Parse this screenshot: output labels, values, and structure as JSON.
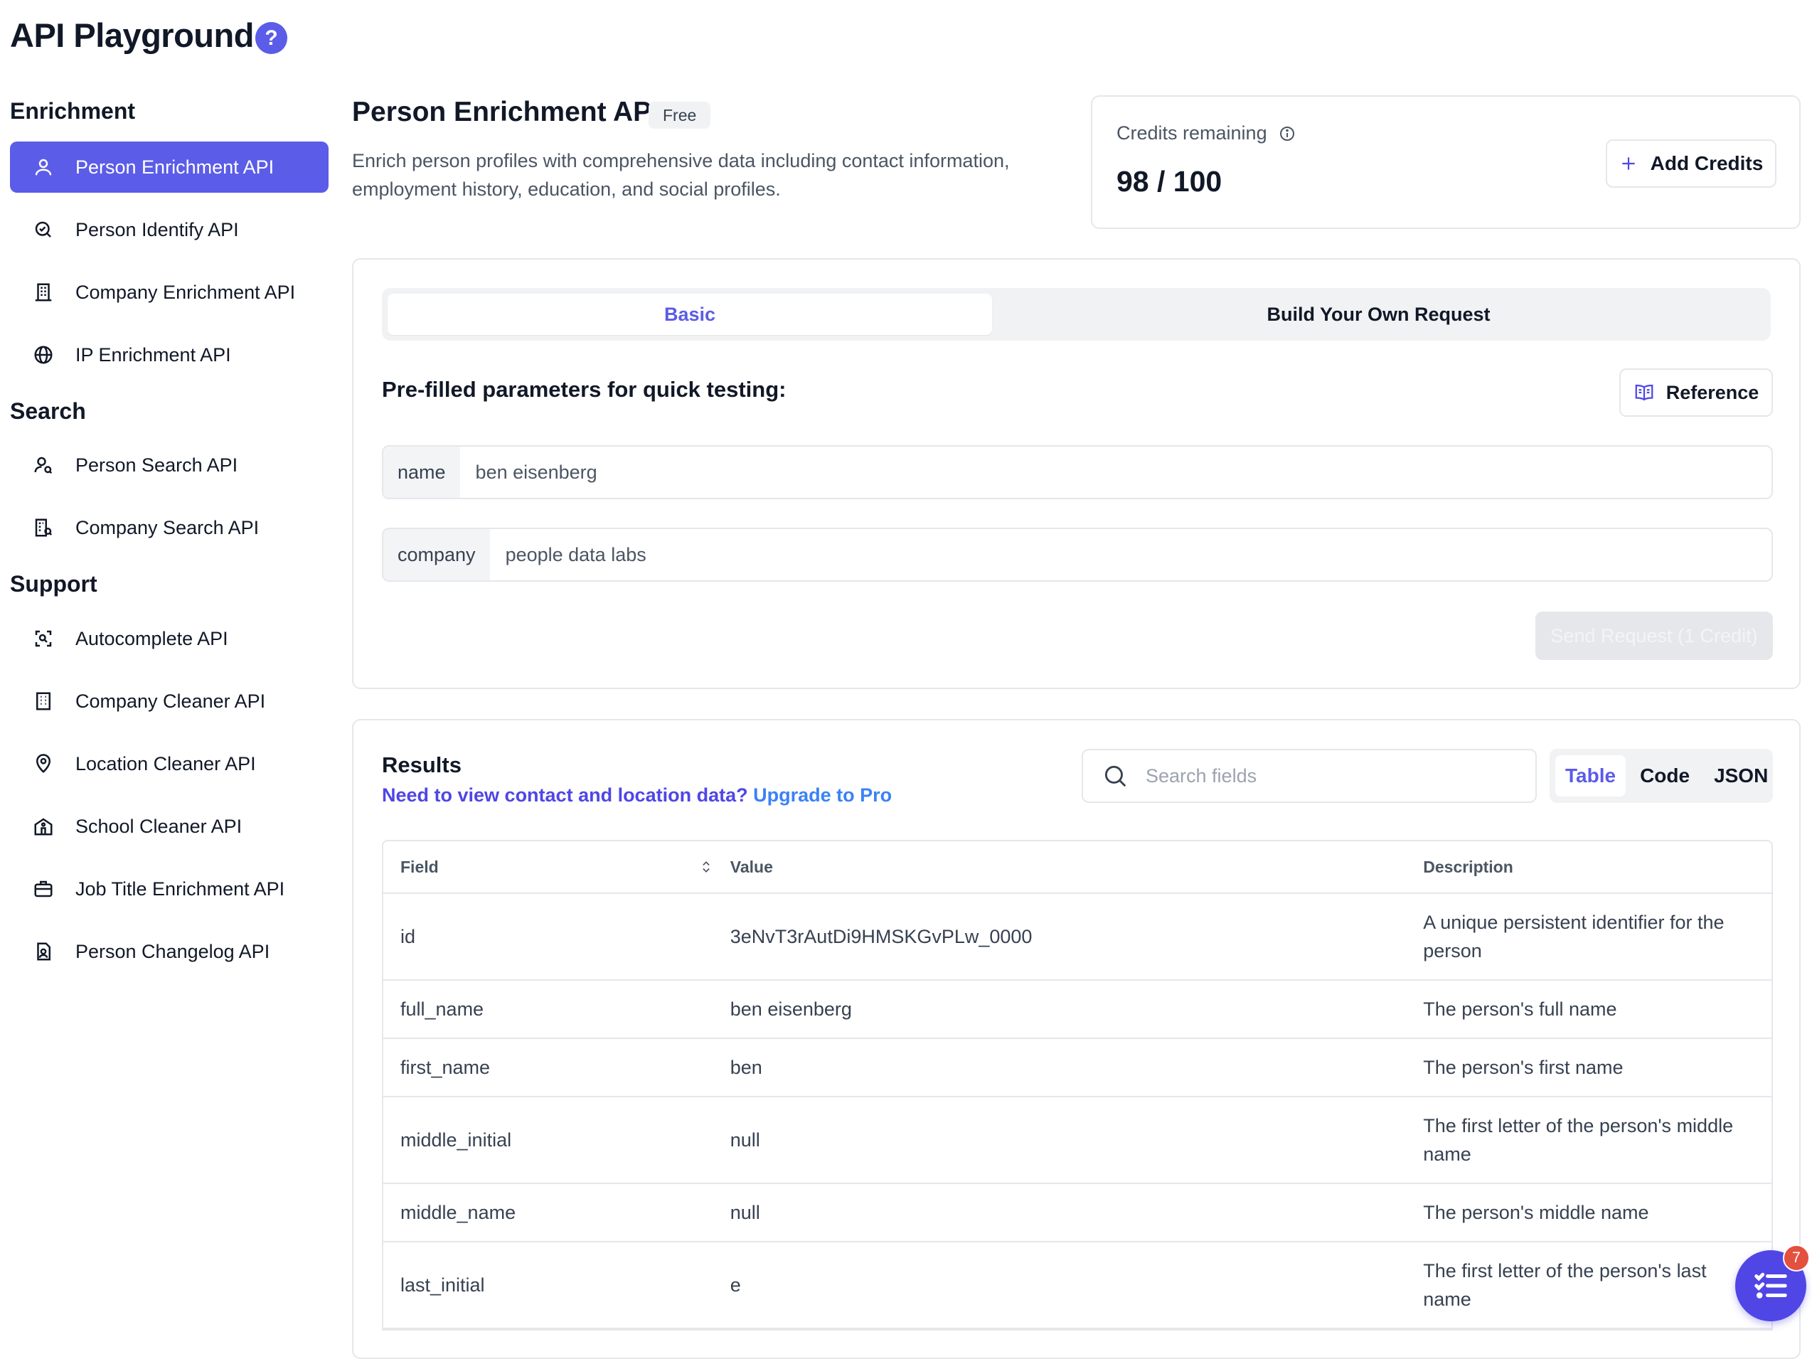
{
  "header": {
    "title": "API Playground",
    "help_icon": "?"
  },
  "sidebar": {
    "sections": [
      {
        "title": "Enrichment",
        "items": [
          {
            "label": "Person Enrichment API",
            "icon": "user-icon",
            "active": true
          },
          {
            "label": "Person Identify API",
            "icon": "identify-icon"
          },
          {
            "label": "Company Enrichment API",
            "icon": "building-icon"
          },
          {
            "label": "IP Enrichment API",
            "icon": "globe-icon"
          }
        ]
      },
      {
        "title": "Search",
        "items": [
          {
            "label": "Person Search API",
            "icon": "user-search-icon"
          },
          {
            "label": "Company Search API",
            "icon": "building-search-icon"
          }
        ]
      },
      {
        "title": "Support",
        "items": [
          {
            "label": "Autocomplete API",
            "icon": "scan-icon"
          },
          {
            "label": "Company Cleaner API",
            "icon": "office-icon"
          },
          {
            "label": "Location Cleaner API",
            "icon": "map-pin-icon"
          },
          {
            "label": "School Cleaner API",
            "icon": "school-icon"
          },
          {
            "label": "Job Title Enrichment API",
            "icon": "briefcase-icon"
          },
          {
            "label": "Person Changelog API",
            "icon": "file-user-icon"
          }
        ]
      }
    ]
  },
  "main": {
    "title": "Person Enrichment API",
    "badge": "Free",
    "description": "Enrich person profiles with comprehensive data including contact information, employment history, education, and social profiles."
  },
  "credits": {
    "label": "Credits remaining",
    "value": "98 / 100",
    "add_label": "Add Credits"
  },
  "request": {
    "tabs": [
      "Basic",
      "Build Your Own Request"
    ],
    "active_tab": "Basic",
    "prefill_title": "Pre-filled parameters for quick testing:",
    "reference_label": "Reference",
    "params": [
      {
        "key": "name",
        "value": "ben eisenberg"
      },
      {
        "key": "company",
        "value": "people data labs"
      }
    ],
    "send_label": "Send Request (1 Credit)"
  },
  "results": {
    "title": "Results",
    "upsell_text": "Need to view contact and location data?",
    "upsell_link": "Upgrade to Pro",
    "search_placeholder": "Search fields",
    "views": [
      "Table",
      "Code",
      "JSON"
    ],
    "active_view": "Table",
    "columns": [
      "Field",
      "Value",
      "Description"
    ],
    "rows": [
      {
        "field": "id",
        "value": "3eNvT3rAutDi9HMSKGvPLw_0000",
        "description": "A unique persistent identifier for the person"
      },
      {
        "field": "full_name",
        "value": "ben eisenberg",
        "description": "The person's full name"
      },
      {
        "field": "first_name",
        "value": "ben",
        "description": "The person's first name"
      },
      {
        "field": "middle_initial",
        "value": "null",
        "description": "The first letter of the person's middle name"
      },
      {
        "field": "middle_name",
        "value": "null",
        "description": "The person's middle name"
      },
      {
        "field": "last_initial",
        "value": "e",
        "description": "The first letter of the person's last name"
      }
    ]
  },
  "fab": {
    "badge": "7",
    "icon": "list-check-icon"
  },
  "colors": {
    "accent": "#5b5ce8",
    "link": "#3b82f6",
    "badge": "#e3503e"
  }
}
